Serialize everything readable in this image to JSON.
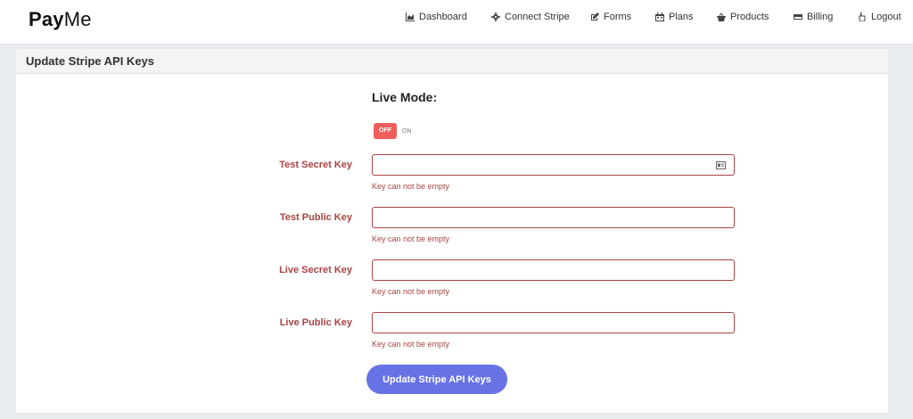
{
  "brand": {
    "bold": "Pay",
    "light": "Me"
  },
  "nav": {
    "dashboard": "Dashboard",
    "connect_stripe": "Connect Stripe",
    "forms": "Forms",
    "plans": "Plans",
    "products": "Products",
    "billing": "Billing",
    "logout": "Logout"
  },
  "panel": {
    "title": "Update Stripe API Keys",
    "live_mode_label": "Live Mode:",
    "toggle": {
      "off_label": "OFF",
      "on_label": "ON",
      "state": "off"
    },
    "fields": {
      "test_secret": {
        "label": "Test Secret Key",
        "value": "",
        "error": "Key can not be empty"
      },
      "test_public": {
        "label": "Test Public Key",
        "value": "",
        "error": "Key can not be empty"
      },
      "live_secret": {
        "label": "Live Secret Key",
        "value": "",
        "error": "Key can not be empty"
      },
      "live_public": {
        "label": "Live Public Key",
        "value": "",
        "error": "Key can not be empty"
      }
    },
    "submit_label": "Update Stripe API Keys"
  },
  "colors": {
    "accent": "#6772e5",
    "error": "#a94442",
    "toggle_off": "#ee5f5b",
    "background": "#e8ecf0"
  },
  "icons": {
    "dashboard": "area-chart-icon",
    "connect_stripe": "gear-icon",
    "forms": "edit-icon",
    "plans": "calendar-icon",
    "products": "basket-icon",
    "billing": "credit-card-icon",
    "logout": "hand-pointer-icon",
    "field_autofill": "contact-card-icon"
  }
}
